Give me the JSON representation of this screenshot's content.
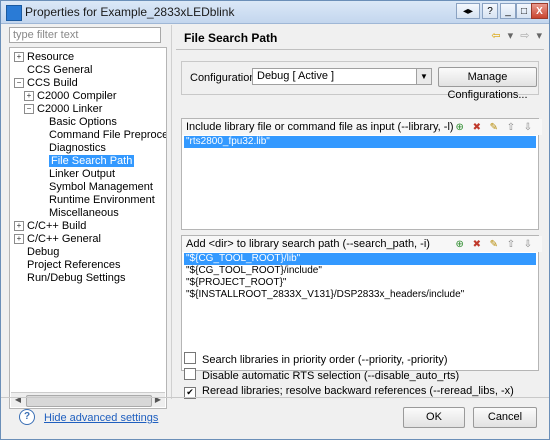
{
  "window": {
    "title": "Properties for Example_2833xLEDblink",
    "buttons": [
      "◂▸",
      "?",
      "_",
      "□",
      "X"
    ]
  },
  "left": {
    "filter_placeholder": "type filter text",
    "tree": [
      {
        "label": "Resource",
        "toggle": "+",
        "depth": 0
      },
      {
        "label": "CCS General",
        "toggle": "",
        "depth": 0
      },
      {
        "label": "CCS Build",
        "toggle": "−",
        "depth": 0
      },
      {
        "label": "C2000 Compiler",
        "toggle": "+",
        "depth": 1
      },
      {
        "label": "C2000 Linker",
        "toggle": "−",
        "depth": 1
      },
      {
        "label": "Basic Options",
        "toggle": "",
        "depth": 2
      },
      {
        "label": "Command File Preprocessing",
        "toggle": "",
        "depth": 2
      },
      {
        "label": "Diagnostics",
        "toggle": "",
        "depth": 2
      },
      {
        "label": "File Search Path",
        "toggle": "",
        "depth": 2,
        "selected": true
      },
      {
        "label": "Linker Output",
        "toggle": "",
        "depth": 2
      },
      {
        "label": "Symbol Management",
        "toggle": "",
        "depth": 2
      },
      {
        "label": "Runtime Environment",
        "toggle": "",
        "depth": 2
      },
      {
        "label": "Miscellaneous",
        "toggle": "",
        "depth": 2
      },
      {
        "label": "C/C++ Build",
        "toggle": "+",
        "depth": 0
      },
      {
        "label": "C/C++ General",
        "toggle": "+",
        "depth": 0
      },
      {
        "label": "Debug",
        "toggle": "",
        "depth": 0
      },
      {
        "label": "Project References",
        "toggle": "",
        "depth": 0
      },
      {
        "label": "Run/Debug Settings",
        "toggle": "",
        "depth": 0
      }
    ]
  },
  "right": {
    "page_title": "File Search Path",
    "config_label": "Configuration:",
    "config_value": "Debug  [ Active ]",
    "manage_button": "Manage Configurations...",
    "panel1": {
      "header": "Include library file or command file as input (--library, -l)",
      "items": [
        "\"rts2800_fpu32.lib\""
      ]
    },
    "panel2": {
      "header": "Add <dir> to library search path (--search_path, -i)",
      "items": [
        "\"${CG_TOOL_ROOT}/lib\"",
        "\"${CG_TOOL_ROOT}/include\"",
        "\"${PROJECT_ROOT}\"",
        "\"${INSTALLROOT_2833X_V131}/DSP2833x_headers/include\""
      ]
    },
    "checks": [
      {
        "label": "Search libraries in priority order (--priority, -priority)",
        "checked": false
      },
      {
        "label": "Disable automatic RTS selection (--disable_auto_rts)",
        "checked": false
      },
      {
        "label": "Reread libraries; resolve backward references (--reread_libs, -x)",
        "checked": true
      }
    ]
  },
  "footer": {
    "help_link": "Hide advanced settings",
    "ok": "OK",
    "cancel": "Cancel"
  },
  "icons": {
    "panel_tools": [
      "add-icon",
      "delete-icon",
      "edit-icon",
      "move-up-icon",
      "move-down-icon"
    ]
  }
}
